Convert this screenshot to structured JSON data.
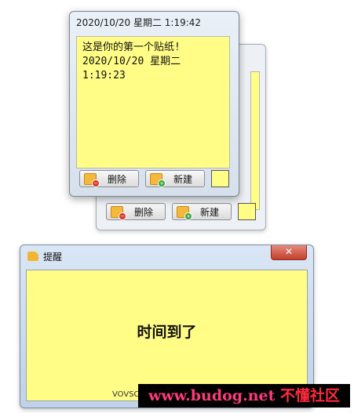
{
  "back_note": {
    "delete_label": "删除",
    "new_label": "新建"
  },
  "front_note": {
    "title": "2020/10/20 星期二 1:19:42",
    "content": "这是你的第一个贴纸!\n2020/10/20 星期二\n1:19:23",
    "delete_label": "删除",
    "new_label": "新建"
  },
  "alarm": {
    "title": "提醒",
    "close_label": "✕",
    "message": "时间到了",
    "footer": "VOVSOFT"
  },
  "watermark": {
    "site": "www.budog.net",
    "cn": "不懂社区"
  },
  "colors": {
    "note": "#fffd86"
  }
}
